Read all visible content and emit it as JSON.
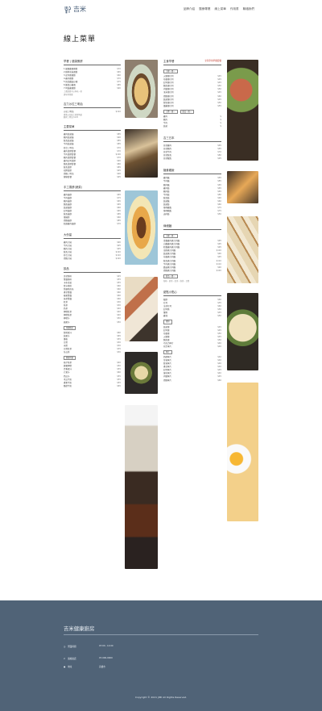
{
  "header": {
    "logo": "吉米",
    "nav": [
      "品牌介紹",
      "醫療專業",
      "線上菜單",
      "作用書",
      "聯絡我們"
    ]
  },
  "page_title": "線上菜單",
  "left_sections": [
    {
      "title": "早餐 | 健康蛋餅",
      "items": [
        [
          "1.嫩蛋雞蛋蛋餅",
          "$70"
        ],
        [
          "2.酥烤花枝蛋餅",
          "$65"
        ],
        [
          "3.起司蛋蛋餅",
          "$60"
        ],
        [
          "4.雞肉蛋餅",
          "$70"
        ],
        [
          "5.奶油蘑菇炒蛋",
          "$75"
        ],
        [
          "6.鮪魚炒雞蛋",
          "$85"
        ],
        [
          "7.時蔬雞蛋餅",
          "$90"
        ]
      ],
      "notes": [
        "上選蔬菜可以內吃—份",
        "請享用用餐"
      ]
    },
    {
      "title": "吉力沙拉三明治",
      "items": [
        [
          "沙拉三明治",
          "$110"
        ]
      ],
      "notes": [
        "香蔥沙拉配上新鮮時蔬",
        "酥烤三明治 $120"
      ]
    },
    {
      "title": "主要菜單",
      "items": [
        [
          "雞肉蔬菜捲",
          "$85"
        ],
        [
          "豬肉蔬菜捲",
          "$90"
        ],
        [
          "鮭魚蔬菜捲",
          "$85"
        ],
        [
          "牛肉蔬菜捲",
          "$85"
        ],
        [
          "綜合三明治",
          "$70"
        ],
        [
          "雞肉漢堡套餐",
          "$70"
        ],
        [
          "牛肉漢堡套餐",
          "$100"
        ],
        [
          "豬肉漢堡套餐",
          "$70"
        ],
        [
          "雞肉起司漢堡",
          "$90"
        ],
        [
          "鮪魚漢堡套餐",
          "$80"
        ],
        [
          "鮭魚漢堡",
          "$85"
        ],
        [
          "招牌漢堡",
          "$95"
        ],
        [
          "總匯三明治",
          "$90"
        ],
        [
          "健康套餐",
          "$95"
        ]
      ]
    },
    {
      "title": "手工捲餅(蔬菜)",
      "items": [
        [
          "雞肉捲餅",
          "$65"
        ],
        [
          "牛肉捲餅",
          "$75"
        ],
        [
          "豬肉捲餅",
          "$65"
        ],
        [
          "鮪魚捲餅",
          "$65"
        ],
        [
          "蔬菜捲餅",
          "$60"
        ],
        [
          "起司捲餅",
          "$65"
        ],
        [
          "鮭魚捲餅",
          "$85"
        ],
        [
          "蛋捲餅",
          "$60"
        ],
        [
          "總匯捲餅",
          "$85"
        ],
        [
          "照燒雞肉捲餅",
          "$70"
        ]
      ]
    },
    {
      "title": "大份量",
      "items": [
        [
          "雞肉大碗",
          "$90"
        ],
        [
          "牛肉大碗",
          "$95"
        ],
        [
          "豬肉大碗",
          "$95"
        ],
        [
          "鮭魚大碗",
          "$120"
        ],
        [
          "綜合大碗",
          "$110"
        ],
        [
          "總匯大碗",
          "$120"
        ]
      ]
    },
    {
      "title": "飲品",
      "items": [
        [
          "美式咖啡",
          "$45"
        ],
        [
          "拿鐵咖啡",
          "$55"
        ],
        [
          "卡布奇諾",
          "$55"
        ],
        [
          "摩卡咖啡",
          "$60"
        ],
        [
          "焦糖瑪奇朵",
          "$60"
        ],
        [
          "香草拿鐵",
          "$60"
        ],
        [
          "榛果拿鐵",
          "$60"
        ],
        [
          "抹茶拿鐵",
          "$60"
        ],
        [
          "紅茶",
          "$30"
        ],
        [
          "綠茶",
          "$30"
        ],
        [
          "奶茶",
          "$40"
        ],
        [
          "檸檬紅茶",
          "$40"
        ],
        [
          "檸檬綠茶",
          "$40"
        ],
        [
          "柳橙汁",
          "$50"
        ],
        [
          "蘋果汁",
          "$50"
        ]
      ],
      "tags": [
        "季節限定",
        "健康特調"
      ],
      "extra": [
        [
          "鮮榨果汁",
          "$60"
        ],
        [
          "蔬果汁",
          "$65"
        ],
        [
          "優格",
          "$55"
        ],
        [
          "豆漿",
          "$30"
        ],
        [
          "米漿",
          "$30"
        ],
        [
          "豆漿紅茶",
          "$35"
        ],
        [
          "冬瓜茶",
          "$30"
        ],
        [
          "梅子綠茶",
          "$40"
        ],
        [
          "蜂蜜檸檬",
          "$50"
        ],
        [
          "百香果汁",
          "$55"
        ],
        [
          "芒果汁",
          "$60"
        ],
        [
          "西瓜汁",
          "$55"
        ],
        [
          "木瓜牛奶",
          "$55"
        ],
        [
          "香蕉牛奶",
          "$55"
        ],
        [
          "酪梨牛奶",
          "$65"
        ]
      ]
    }
  ],
  "right_sections": [
    {
      "title": "主食早餐",
      "red": "立刻享用早餐套餐",
      "tag": "主餐一選一",
      "items": [
        [
          "火腿蛋吐司",
          "$45"
        ],
        [
          "培根蛋吐司",
          "$45"
        ],
        [
          "起司蛋吐司",
          "$45"
        ],
        [
          "鮪魚蛋吐司",
          "$50"
        ],
        [
          "肉鬆蛋吐司",
          "$50"
        ],
        [
          "玉米蛋吐司",
          "$45"
        ],
        [
          "總匯蛋吐司",
          "$60"
        ],
        [
          "蔬菜蛋吐司",
          "$45"
        ],
        [
          "鮮奶蛋吐司",
          "$50"
        ],
        [
          "燻雞蛋吐司",
          "$55"
        ]
      ],
      "tags2": [
        "主食一選一",
        "飲品一選一"
      ],
      "extra": [
        [
          "雞肉",
          "$"
        ],
        [
          "豬肉",
          "$"
        ],
        [
          "牛肉",
          "$"
        ],
        [
          "蔬菜",
          "$"
        ]
      ]
    },
    {
      "title": "吉三日本",
      "items": [
        [
          "日式雞肉",
          "$65"
        ],
        [
          "日式豬肉",
          "$65"
        ],
        [
          "日式牛肉",
          "$70"
        ],
        [
          "日式鮭魚",
          "$80"
        ],
        [
          "日式鰻魚",
          "$95"
        ]
      ]
    },
    {
      "title": "麵食雞飯",
      "items": [
        [
          "雞肉麵",
          "$65"
        ],
        [
          "牛肉麵",
          "$85"
        ],
        [
          "豬肉麵",
          "$65"
        ],
        [
          "雞肉飯",
          "$65"
        ],
        [
          "豬肉飯",
          "$65"
        ],
        [
          "牛肉飯",
          "$80"
        ],
        [
          "鮭魚飯",
          "$90"
        ],
        [
          "蔬菜麵",
          "$60"
        ],
        [
          "蔬菜飯",
          "$60"
        ],
        [
          "咖哩雞飯",
          "$75"
        ],
        [
          "咖哩豬飯",
          "$75"
        ],
        [
          "滷肉飯",
          "$50"
        ]
      ]
    },
    {
      "title": "綠細麵",
      "tag": "主餐一選一",
      "items": [
        [
          "青醬雞肉義大利麵",
          "$95"
        ],
        [
          "白醬雞肉義大利麵",
          "$95"
        ],
        [
          "紅醬雞肉義大利麵",
          "$95"
        ],
        [
          "海鮮義大利麵",
          "$120"
        ],
        [
          "蔬菜義大利麵",
          "$90"
        ],
        [
          "培根義大利麵",
          "$95"
        ],
        [
          "鮭魚義大利麵",
          "$110"
        ],
        [
          "牛肉義大利麵",
          "$110"
        ],
        [
          "蘑菇義大利麵",
          "$90"
        ],
        [
          "總匯義大利麵",
          "$120"
        ]
      ],
      "tag2": "飲品一選一",
      "notes": [
        "咖啡・奶茶・紅茶・綠茶・豆漿"
      ]
    },
    {
      "title": "甜點小點心",
      "items": [
        [
          "鬆餅",
          "$60"
        ],
        [
          "吐司",
          "$35"
        ],
        [
          "法式吐司",
          "$60"
        ],
        [
          "起司條",
          "$50"
        ],
        [
          "薯條",
          "$45"
        ],
        [
          "雞塊",
          "$50"
        ]
      ],
      "tags": [
        "蛋餅",
        "厚片"
      ],
      "extra": [
        [
          "蔬菜蛋",
          "$45"
        ],
        [
          "起司蛋",
          "$45"
        ],
        [
          "培根蛋",
          "$50"
        ],
        [
          "火腿蛋",
          "$45"
        ],
        [
          "鮪魚蛋",
          "$50"
        ],
        [
          "巧克力厚片",
          "$40"
        ],
        [
          "花生厚片",
          "$40"
        ],
        [
          "奶酥厚片",
          "$40"
        ],
        [
          "草莓厚片",
          "$40"
        ],
        [
          "藍莓厚片",
          "$40"
        ],
        [
          "香蒜厚片",
          "$40"
        ],
        [
          "起司厚片",
          "$45"
        ],
        [
          "煉乳厚片",
          "$40"
        ],
        [
          "肉鬆厚片",
          "$45"
        ],
        [
          "總匯厚片",
          "$60"
        ]
      ]
    }
  ],
  "footer": {
    "title": "吉米健康廚房",
    "rows": [
      {
        "icon": "clock-icon",
        "label": "營業時間",
        "value": "07:00 - 14:00"
      },
      {
        "icon": "phone-icon",
        "label": "連絡電話",
        "value": "07-000-0000"
      },
      {
        "icon": "pin-icon",
        "label": "地址",
        "value": "高雄市"
      }
    ],
    "copyright": "Copyright © 2021 JIMI All Rights Reserved."
  },
  "colors": {
    "footer": "#506377",
    "accent": "#c0392b"
  }
}
